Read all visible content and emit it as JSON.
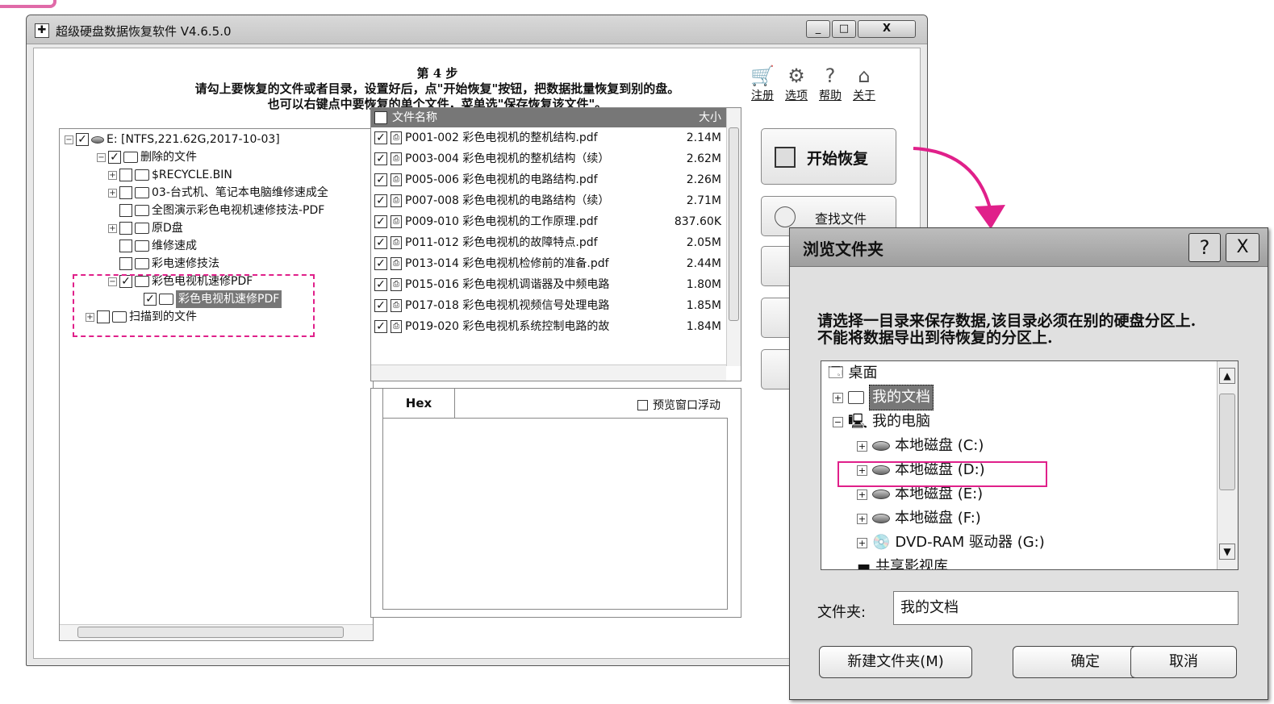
{
  "app": {
    "title": "超级硬盘数据恢复软件 V4.6.5.0",
    "icon_char": "✚"
  },
  "window_controls": {
    "minimize": "_",
    "maximize": "□",
    "close": "X"
  },
  "header": {
    "step": "第 4 步",
    "line1": "请勾上要恢复的文件或者目录，设置好后，点\"开始恢复\"按钮，把数据批量恢复到别的盘。",
    "line2": "也可以右键点中要恢复的单个文件，菜单选\"保存恢复该文件\"。"
  },
  "top_links": [
    {
      "label": "注册",
      "icon": "cart-icon",
      "glyph": "🛒"
    },
    {
      "label": "选项",
      "icon": "gear-icon",
      "glyph": "⚙"
    },
    {
      "label": "帮助",
      "icon": "help-icon",
      "glyph": "?"
    },
    {
      "label": "关于",
      "icon": "home-icon",
      "glyph": "⌂"
    }
  ],
  "tree": {
    "root": "E:  [NTFS,221.62G,2017-10-03]",
    "deleted": "删除的文件",
    "recycle": "$RECYCLE.BIN",
    "item1": "03-台式机、笔记本电脑维修速成全",
    "item2": "全图演示彩色电视机速修技法-PDF",
    "item3": "原D盘",
    "item4": "维修速成",
    "item5": "彩电速修技法",
    "item6": "彩色电视机速修PDF",
    "item6_child": "彩色电视机速修PDF",
    "scanned": "扫描到的文件"
  },
  "filelist": {
    "col_name": "文件名称",
    "col_size": "大小",
    "rows": [
      {
        "name": "P001-002 彩色电视机的整机结构.pdf",
        "size": "2.14M"
      },
      {
        "name": "P003-004 彩色电视机的整机结构（续）",
        "size": "2.62M"
      },
      {
        "name": "P005-006 彩色电视机的电路结构.pdf",
        "size": "2.26M"
      },
      {
        "name": "P007-008 彩色电视机的电路结构（续）",
        "size": "2.71M"
      },
      {
        "name": "P009-010 彩色电视机的工作原理.pdf",
        "size": "837.60K"
      },
      {
        "name": "P011-012 彩色电视机的故障特点.pdf",
        "size": "2.05M"
      },
      {
        "name": "P013-014 彩色电视机检修前的准备.pdf",
        "size": "2.44M"
      },
      {
        "name": "P015-016 彩色电视机调谐器及中频电路",
        "size": "1.80M"
      },
      {
        "name": "P017-018 彩色电视机视频信号处理电路",
        "size": "1.85M"
      },
      {
        "name": "P019-020 彩色电视机系统控制电路的故",
        "size": "1.84M"
      }
    ]
  },
  "hex": {
    "tab": "Hex",
    "float_label": "预览窗口浮动"
  },
  "buttons": {
    "start_recover": "开始恢复",
    "find_file": "查找文件"
  },
  "dialog": {
    "title": "浏览文件夹",
    "help": "?",
    "close": "X",
    "message1": "请选择一目录来保存数据,该目录必须在别的硬盘分区上.",
    "message2": "不能将数据导出到待恢复的分区上.",
    "items": [
      {
        "label": "桌面"
      },
      {
        "label": "我的文档"
      },
      {
        "label": "我的电脑"
      },
      {
        "label": "本地磁盘  (C:)"
      },
      {
        "label": "本地磁盘  (D:)"
      },
      {
        "label": "本地磁盘  (E:)"
      },
      {
        "label": "本地磁盘  (F:)"
      },
      {
        "label": "DVD-RAM 驱动器  (G:)"
      },
      {
        "label": "共享影视库"
      }
    ],
    "folder_label": "文件夹:",
    "folder_value": "我的文档",
    "new_folder": "新建文件夹(M)",
    "ok": "确定",
    "cancel": "取消"
  },
  "colors": {
    "annotation": "#e0208a"
  }
}
